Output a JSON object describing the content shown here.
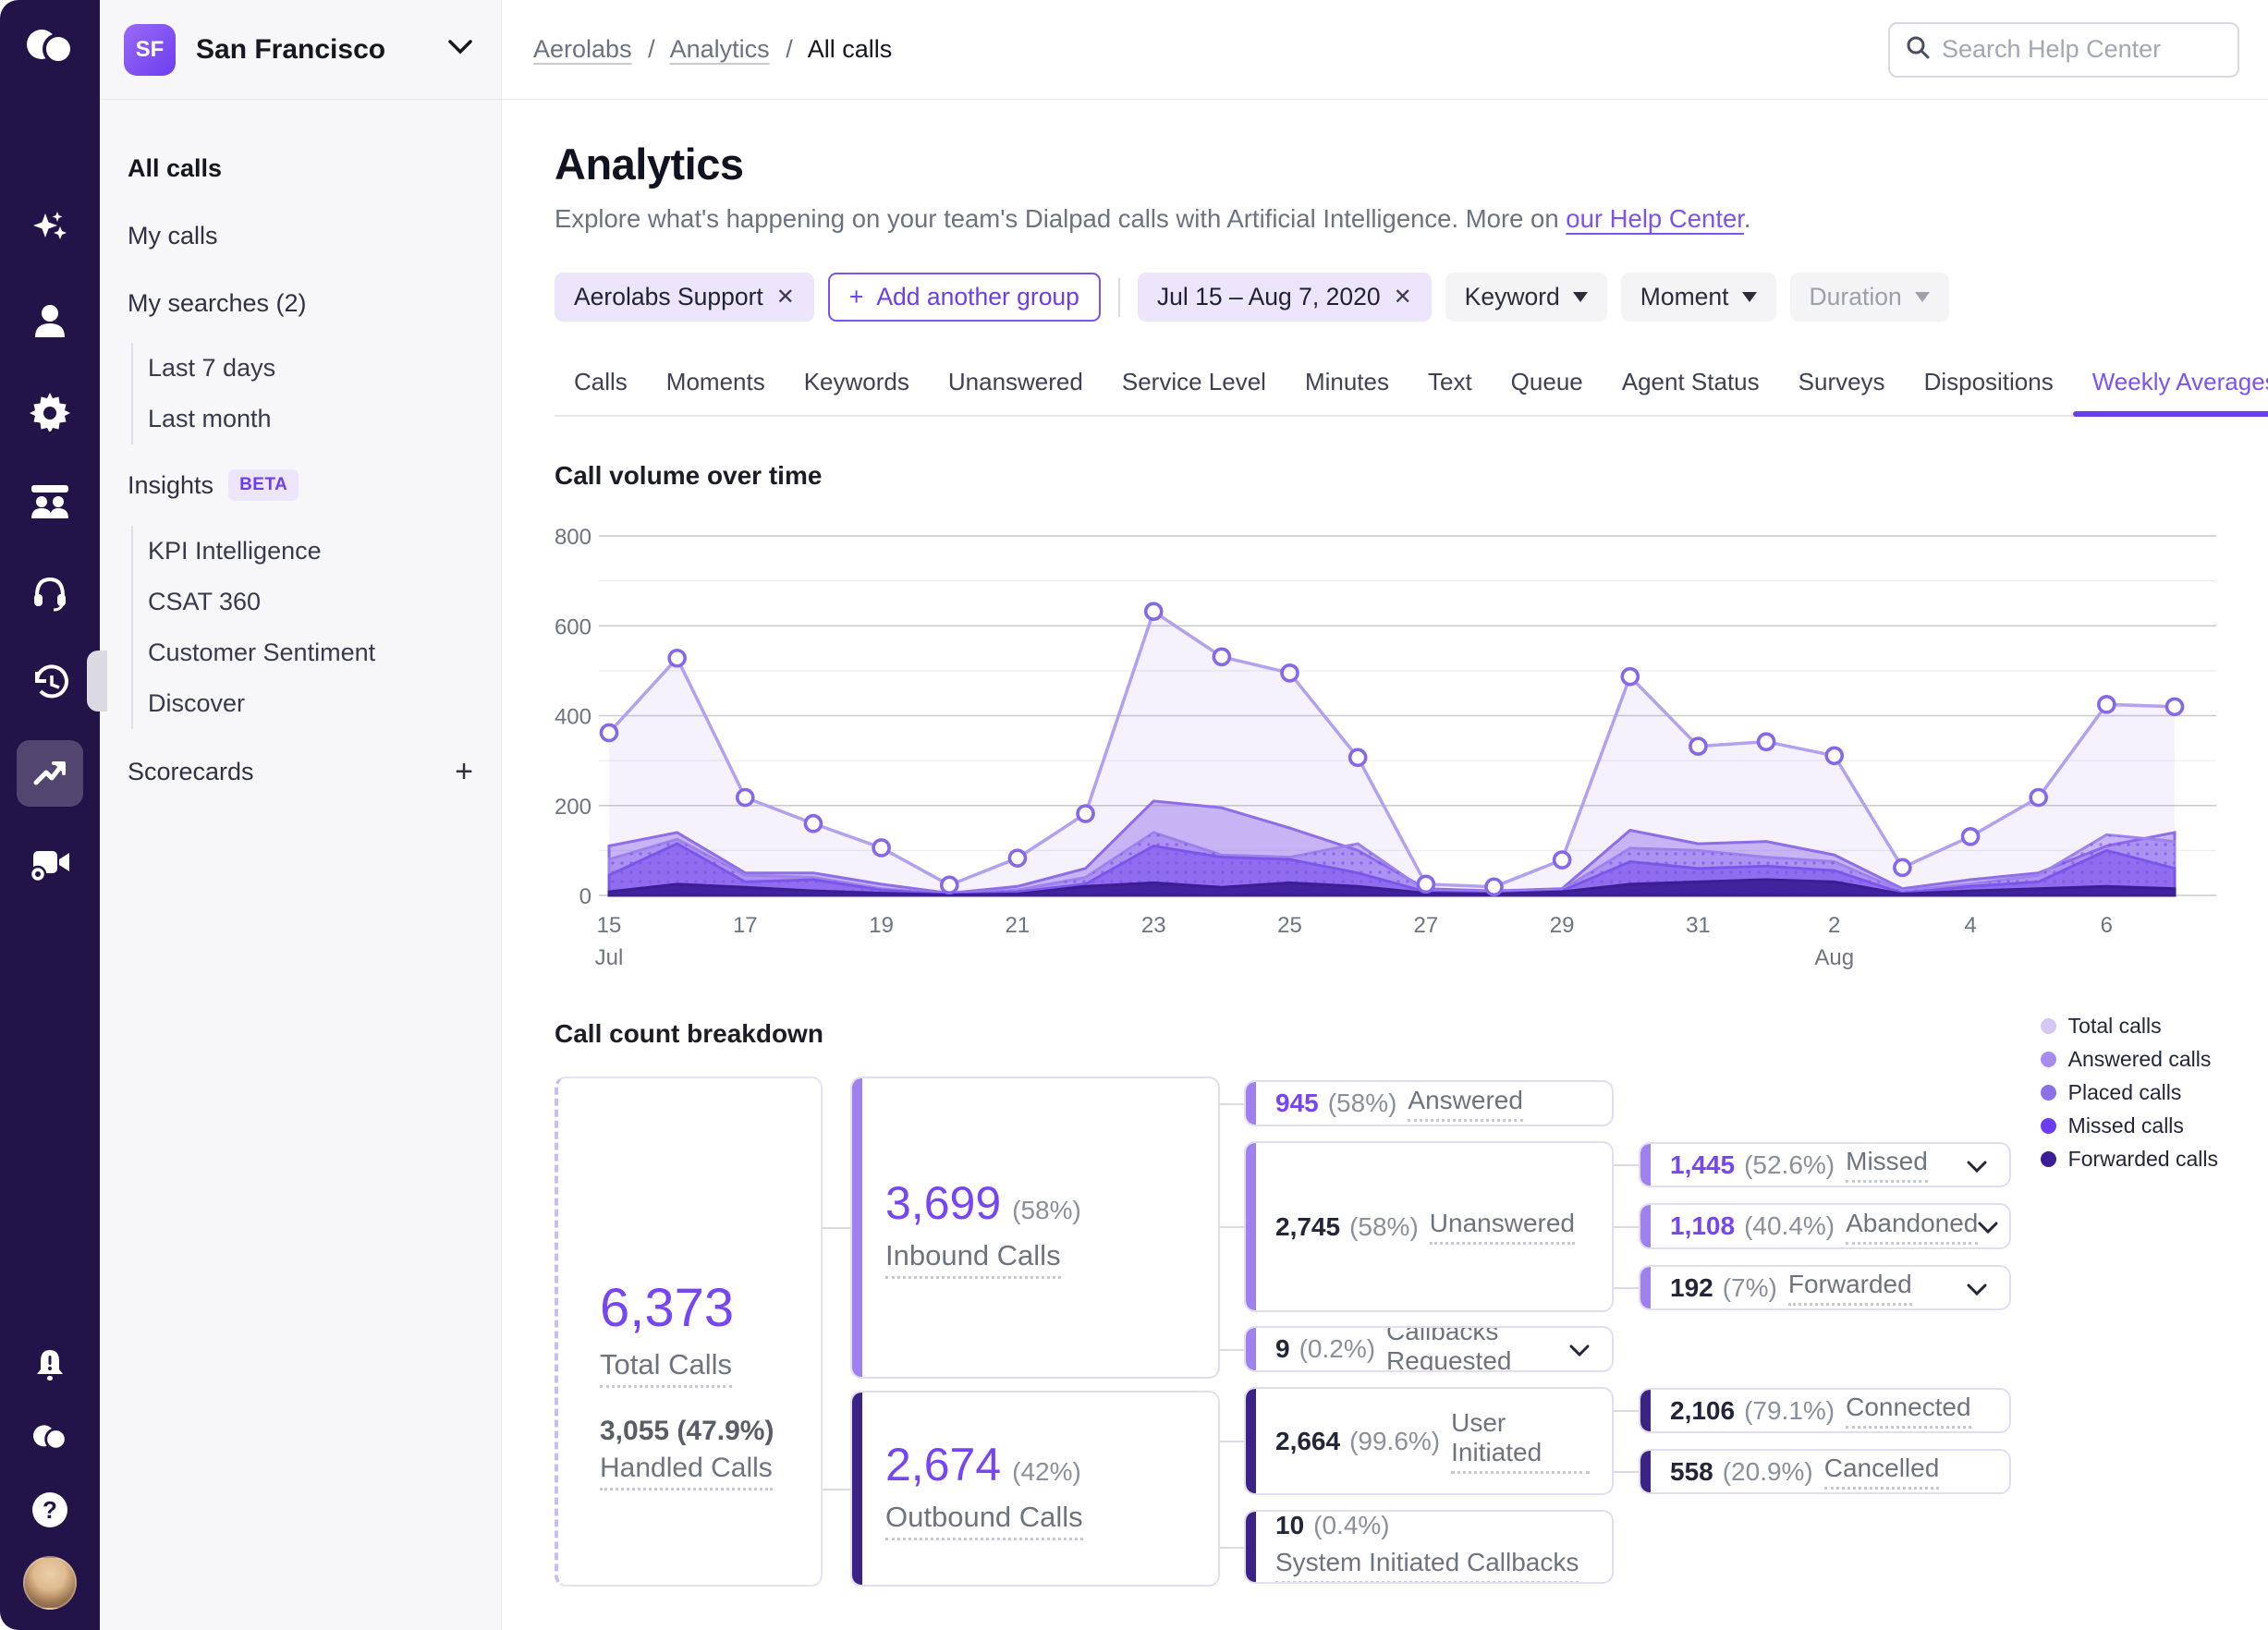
{
  "colors": {
    "rail_bg": "#221349",
    "accent": "#6C3DEF",
    "link": "#7C52F4",
    "value_purple": "#7645F4",
    "lavender_chip": "#EDE5FC",
    "inbound_accent": "#9F80EF",
    "outbound_accent": "#3B2385"
  },
  "icons": {
    "close": "✕",
    "plus": "+",
    "scorecards_add": "+"
  },
  "iconbar": {
    "items": [
      "dialpad-logo",
      "ai-sparkles",
      "contacts",
      "settings-gear",
      "contact-center",
      "support-headset",
      "history-clock",
      "analytics-trend",
      "meetings-video",
      "notifications-bell",
      "dialpad-mini",
      "help",
      "user-avatar"
    ]
  },
  "sidebar": {
    "team": {
      "initials": "SF",
      "name": "San Francisco"
    },
    "items": [
      {
        "label": "All calls"
      },
      {
        "label": "My calls"
      },
      {
        "label": "My searches (2)"
      },
      {
        "label": "Last 7 days"
      },
      {
        "label": "Last month"
      },
      {
        "label": "Insights",
        "badge": "BETA"
      },
      {
        "label": "KPI Intelligence"
      },
      {
        "label": "CSAT 360"
      },
      {
        "label": "Customer Sentiment"
      },
      {
        "label": "Discover"
      },
      {
        "label": "Scorecards"
      }
    ]
  },
  "topbar": {
    "breadcrumb": [
      "Aerolabs",
      "Analytics",
      "All calls"
    ],
    "separator": "/",
    "search_placeholder": "Search Help Center"
  },
  "page": {
    "title": "Analytics",
    "desc_prefix": "Explore what's happening on your team's Dialpad calls with Artificial Intelligence. More on ",
    "desc_link": "our Help Center",
    "desc_suffix": "."
  },
  "filters": {
    "group_chip": "Aerolabs Support",
    "add_group": "Add another group",
    "date_chip": "Jul 15 – Aug 7, 2020",
    "keyword": "Keyword",
    "moment": "Moment",
    "duration": "Duration"
  },
  "tabs": {
    "items": [
      {
        "label": "Calls"
      },
      {
        "label": "Moments"
      },
      {
        "label": "Keywords"
      },
      {
        "label": "Unanswered"
      },
      {
        "label": "Service Level"
      },
      {
        "label": "Minutes"
      },
      {
        "label": "Text"
      },
      {
        "label": "Queue"
      },
      {
        "label": "Agent Status"
      },
      {
        "label": "Surveys"
      },
      {
        "label": "Dispositions"
      },
      {
        "label": "Weekly Averages"
      }
    ],
    "active": "Weekly Averages"
  },
  "chart_data": {
    "type": "area",
    "title": "Call volume over time",
    "x": [
      "Jul 15",
      "Jul 16",
      "Jul 17",
      "Jul 18",
      "Jul 19",
      "Jul 20",
      "Jul 21",
      "Jul 22",
      "Jul 23",
      "Jul 24",
      "Jul 25",
      "Jul 26",
      "Jul 27",
      "Jul 28",
      "Jul 29",
      "Jul 30",
      "Jul 31",
      "Aug 1",
      "Aug 2",
      "Aug 3",
      "Aug 4",
      "Aug 5",
      "Aug 6",
      "Aug 7"
    ],
    "x_ticks": [
      {
        "index": 0,
        "label": "15"
      },
      {
        "index": 2,
        "label": "17"
      },
      {
        "index": 4,
        "label": "19"
      },
      {
        "index": 6,
        "label": "21"
      },
      {
        "index": 8,
        "label": "23"
      },
      {
        "index": 10,
        "label": "25"
      },
      {
        "index": 12,
        "label": "27"
      },
      {
        "index": 14,
        "label": "29"
      },
      {
        "index": 16,
        "label": "31"
      },
      {
        "index": 18,
        "label": "2"
      },
      {
        "index": 20,
        "label": "4"
      },
      {
        "index": 22,
        "label": "6"
      }
    ],
    "month_labels": [
      {
        "index": 0,
        "label": "Jul"
      },
      {
        "index": 18,
        "label": "Aug"
      }
    ],
    "ylim": [
      0,
      800
    ],
    "y_ticks": [
      0,
      200,
      400,
      600,
      800
    ],
    "grid": true,
    "series": [
      {
        "name": "Total calls",
        "color": "#B3A0EF",
        "fill": "rgba(160,130,240,0.10)",
        "markers": true,
        "values": [
          362,
          528,
          218,
          160,
          106,
          23,
          83,
          182,
          632,
          531,
          495,
          307,
          25,
          19,
          79,
          487,
          332,
          342,
          311,
          62,
          131,
          218,
          425,
          420
        ]
      },
      {
        "name": "Answered calls",
        "color": "#8F6CE8",
        "fill": "rgba(151,117,238,0.50)",
        "values": [
          110,
          140,
          50,
          50,
          25,
          5,
          20,
          60,
          210,
          195,
          150,
          100,
          15,
          10,
          15,
          145,
          115,
          120,
          90,
          15,
          35,
          50,
          110,
          140
        ]
      },
      {
        "name": "Placed calls",
        "color": "#9E82EC",
        "fill": "rgba(139,102,236,0.42)",
        "dotted": true,
        "values": [
          80,
          125,
          45,
          40,
          15,
          3,
          12,
          40,
          140,
          90,
          85,
          115,
          10,
          8,
          12,
          105,
          100,
          85,
          75,
          10,
          25,
          45,
          135,
          120
        ]
      },
      {
        "name": "Missed calls",
        "color": "#7C56EB",
        "fill": "rgba(124,86,235,0.62)",
        "values": [
          45,
          115,
          30,
          35,
          12,
          2,
          8,
          25,
          110,
          85,
          80,
          50,
          8,
          5,
          10,
          75,
          60,
          65,
          55,
          5,
          20,
          30,
          100,
          60
        ]
      },
      {
        "name": "Forwarded calls",
        "color": "#3B1D96",
        "fill": "rgba(59,29,150,0.92)",
        "values": [
          8,
          25,
          18,
          10,
          5,
          1,
          3,
          20,
          28,
          18,
          28,
          20,
          5,
          3,
          8,
          25,
          30,
          35,
          30,
          3,
          10,
          15,
          20,
          15
        ]
      }
    ]
  },
  "breakdown": {
    "title": "Call count breakdown",
    "legend": {
      "items": [
        {
          "label": "Total calls",
          "color": "#D5C8F4"
        },
        {
          "label": "Answered calls",
          "color": "#A78BF0"
        },
        {
          "label": "Placed calls",
          "color": "#8F6FE8"
        },
        {
          "label": "Missed calls",
          "color": "#6C3DF0"
        },
        {
          "label": "Forwarded calls",
          "color": "#3B1D96"
        }
      ]
    },
    "total": {
      "value": "6,373",
      "label": "Total Calls",
      "sub_value": "3,055 (47.9%)",
      "sub_label": "Handled Calls"
    },
    "inbound": {
      "value": "3,699",
      "pct": "(58%)",
      "label": "Inbound Calls"
    },
    "outbound": {
      "value": "2,674",
      "pct": "(42%)",
      "label": "Outbound Calls"
    },
    "answered": {
      "value": "945",
      "pct": "(58%)",
      "label": "Answered"
    },
    "unanswered": {
      "value": "2,745",
      "pct": "(58%)",
      "label": "Unanswered"
    },
    "callbacks": {
      "value": "9",
      "pct": "(0.2%)",
      "label": "Callbacks Requested"
    },
    "missed": {
      "value": "1,445",
      "pct": "(52.6%)",
      "label": "Missed"
    },
    "abandoned": {
      "value": "1,108",
      "pct": "(40.4%)",
      "label": "Abandoned"
    },
    "forwarded": {
      "value": "192",
      "pct": "(7%)",
      "label": "Forwarded"
    },
    "user_initiated": {
      "value": "2,664",
      "pct": "(99.6%)",
      "label": "User Initiated"
    },
    "system_initiated": {
      "value": "10",
      "pct": "(0.4%)",
      "label": "System Initiated Callbacks"
    },
    "connected": {
      "value": "2,106",
      "pct": "(79.1%)",
      "label": "Connected"
    },
    "cancelled": {
      "value": "558",
      "pct": "(20.9%)",
      "label": "Cancelled"
    }
  }
}
